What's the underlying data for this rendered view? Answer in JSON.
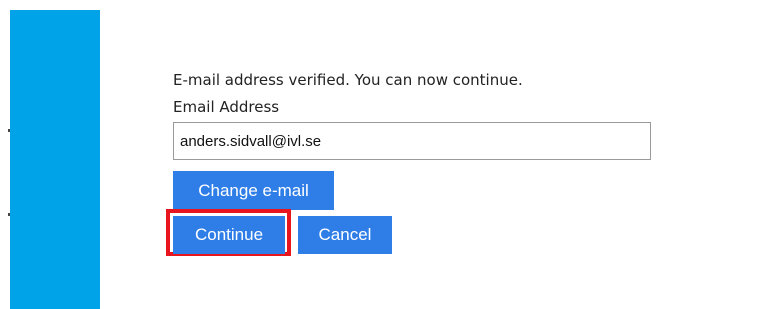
{
  "colors": {
    "left_bar": "#00a2e8",
    "button_background": "#2f7ee8",
    "button_text": "#ffffff",
    "highlight_border": "#e8141e"
  },
  "form": {
    "verified_message": "E-mail address verified. You can now continue.",
    "email_label": "Email Address",
    "email_value": "anders.sidvall@ivl.se"
  },
  "buttons": {
    "change_email_label": "Change e-mail",
    "continue_label": "Continue",
    "cancel_label": "Cancel"
  }
}
